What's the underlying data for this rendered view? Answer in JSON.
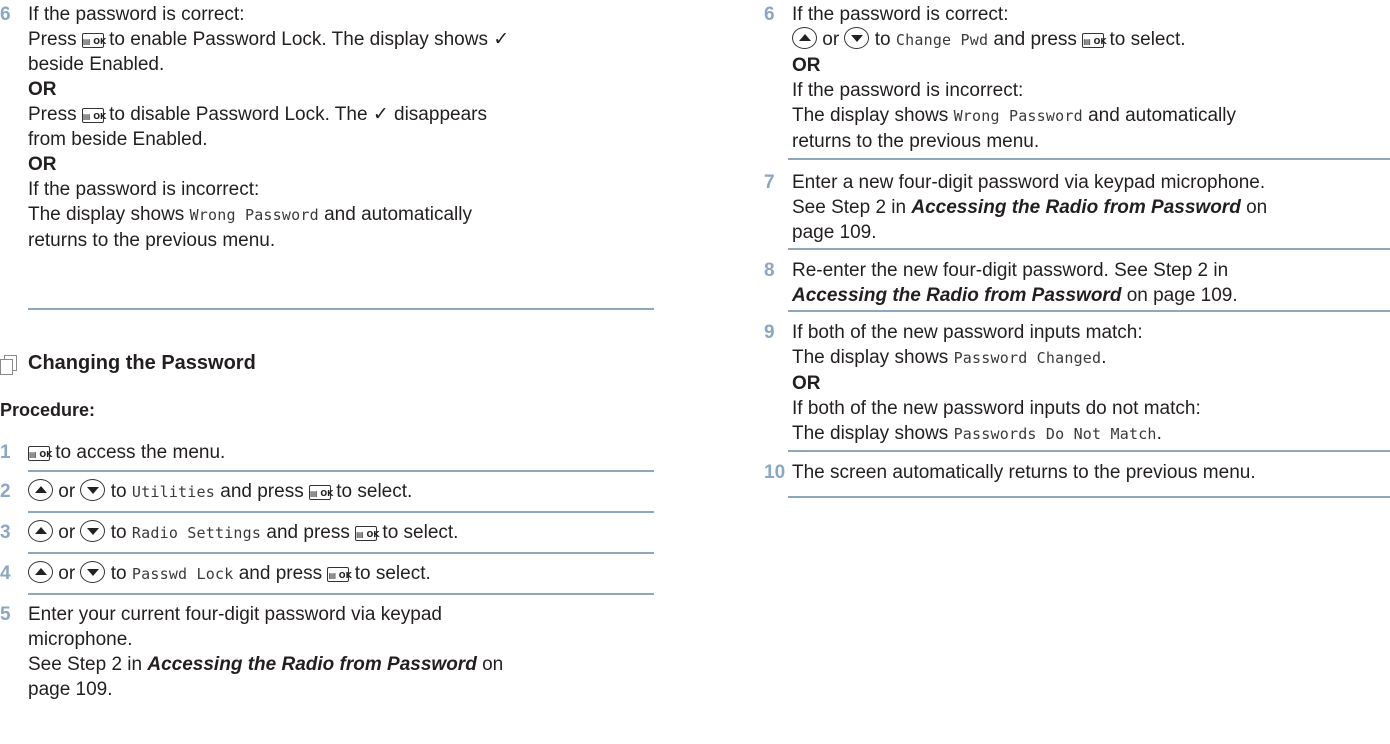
{
  "left": {
    "step6": {
      "number": "6",
      "intro": "If the password is correct:",
      "enable_a": "Press",
      "enable_b": "to enable Password Lock. The display shows ✓",
      "enable_c": "beside Enabled.",
      "or1": "OR",
      "disable_a": "Press",
      "disable_b": "to disable Password Lock. The ✓ disappears",
      "disable_c": "from beside Enabled.",
      "or2": "OR",
      "incorrect": "If the password is incorrect:",
      "shows_a": "The display shows",
      "shows_mono": "Wrong Password",
      "shows_b": "and automatically",
      "returns": "returns to the previous menu."
    },
    "section_title": "Changing the Password",
    "procedure_label": "Procedure:",
    "steps": {
      "s1": {
        "number": "1",
        "text": "to access the menu."
      },
      "s2": {
        "number": "2",
        "or": "or",
        "to": "to",
        "item": "Utilities",
        "press": "and press",
        "end": "to select."
      },
      "s3": {
        "number": "3",
        "or": "or",
        "to": "to",
        "item": "Radio Settings",
        "press": "and press",
        "end": "to select."
      },
      "s4": {
        "number": "4",
        "or": "or",
        "to": "to",
        "item": "Passwd Lock",
        "press": "and press",
        "end": "to select."
      },
      "s5": {
        "number": "5",
        "line1": "Enter your current four-digit password via keypad",
        "line2": "microphone.",
        "line3_a": "See Step 2 in",
        "line3_link": "Accessing the Radio from Password",
        "line3_b": "on",
        "line4": "page 109."
      }
    }
  },
  "right": {
    "s6": {
      "number": "6",
      "intro": "If the password is correct:",
      "or_word": "or",
      "to": "to",
      "item": "Change Pwd",
      "press": "and press",
      "end": "to select.",
      "or_heading": "OR",
      "incorrect": "If the password is incorrect:",
      "shows_a": "The display shows",
      "shows_mono": "Wrong Password",
      "shows_b": "and automatically",
      "returns": "returns to the previous menu."
    },
    "s7": {
      "number": "7",
      "line1": "Enter a new four-digit password via keypad microphone.",
      "line2_a": "See Step 2 in",
      "line2_link": "Accessing the Radio from Password",
      "line2_b": "on",
      "line3": "page 109."
    },
    "s8": {
      "number": "8",
      "line1": "Re-enter the new four-digit password. See Step 2 in",
      "line2_link": "Accessing the Radio from Password",
      "line2_b": "on page 109."
    },
    "s9": {
      "number": "9",
      "intro": "If both of the new password inputs match:",
      "shows_a": "The display shows",
      "shows_mono": "Password Changed",
      "dot": ".",
      "or_heading": "OR",
      "nomatch": "If both of the new password inputs do not match:",
      "shows2_a": "The display shows",
      "shows2_mono": "Passwords Do Not Match",
      "dot2": "."
    },
    "s10": {
      "number": "10",
      "text": "The screen automatically returns to the previous menu."
    }
  },
  "keys": {
    "ok_label": "▤ OK",
    "up_icon": "up-arrow-key-icon",
    "down_icon": "down-arrow-key-icon"
  }
}
